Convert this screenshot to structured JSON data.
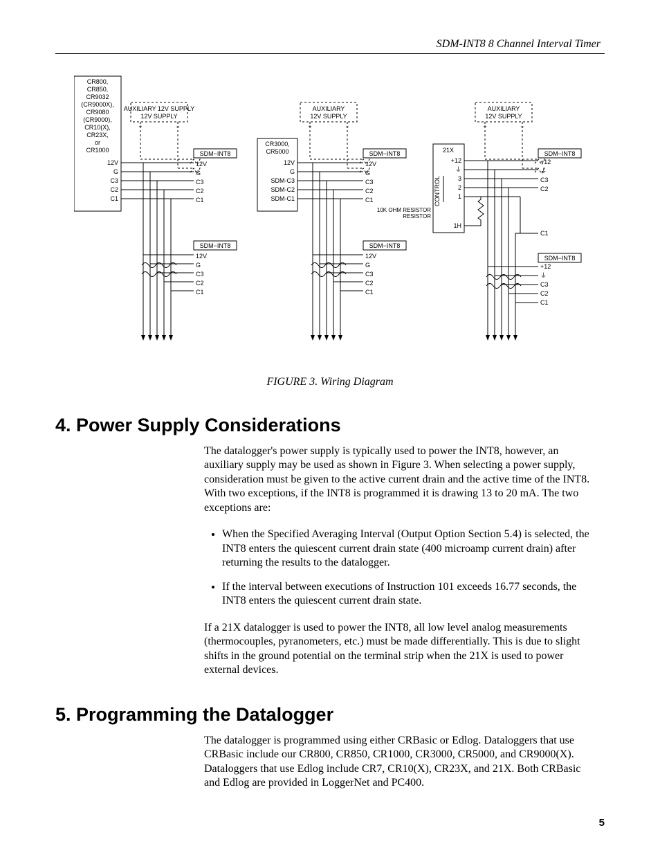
{
  "header": "SDM-INT8  8 Channel Interval Timer",
  "figure_caption": "FIGURE 3.  Wiring Diagram",
  "page_number": "5",
  "sections": {
    "s4": {
      "heading": "4.  Power Supply Considerations",
      "p1": "The datalogger's power supply is typically used to power the INT8, however, an auxiliary supply may be used as shown in Figure 3.  When selecting a power supply, consideration must be given to the active current drain and the active time of the INT8.  With two exceptions, if the INT8 is programmed it is drawing 13 to 20 mA.  The two exceptions are:",
      "b1": "When the Specified Averaging Interval (Output Option Section 5.4) is selected, the INT8 enters the quiescent current drain state (400 microamp current drain) after returning the results to the datalogger.",
      "b2": "If the interval between executions of Instruction 101 exceeds 16.77 seconds, the INT8 enters the quiescent current drain state.",
      "p2": "If a 21X datalogger is used to power the INT8, all low level analog measurements (thermocouples, pyranometers, etc.) must be made differentially.  This is due to slight shifts in the ground potential on the terminal strip when the 21X is used to power external devices."
    },
    "s5": {
      "heading": "5.  Programming the Datalogger",
      "p1": "The datalogger is programmed using either CRBasic or Edlog.  Dataloggers that use CRBasic include our CR800, CR850, CR1000, CR3000, CR5000, and CR9000(X).  Dataloggers that use Edlog include CR7, CR10(X), CR23X, and 21X.  Both CRBasic and Edlog are provided in LoggerNet and PC400."
    }
  },
  "diagram": {
    "aux_label": "AUXILIARY\n12V SUPPLY",
    "sdm_title": "SDM−INT8",
    "sdm_pins": [
      "12V",
      "G",
      "C3",
      "C2",
      "C1"
    ],
    "sdm_pins_21x": [
      "+12",
      "⏚",
      "C3",
      "C2",
      "",
      "C1"
    ],
    "sdm_pins_21x_bottom": [
      "+12",
      "⏚",
      "C3",
      "C2",
      "C1"
    ],
    "col1_logger_lines": [
      "CR800,",
      "CR850,",
      "CR9032",
      "(CR9000X),",
      "CR9080",
      "(CR9000),",
      "CR10(X),",
      "CR23X,",
      "or",
      "CR1000"
    ],
    "col1_logger_pins": [
      "12V",
      "G",
      "C3",
      "C2",
      "C1"
    ],
    "col2_logger_lines": [
      "CR3000,",
      "CR5000"
    ],
    "col2_logger_pins": [
      "12V",
      "G",
      "SDM-C3",
      "SDM-C2",
      "SDM-C1"
    ],
    "col3_logger_name": "21X",
    "col3_logger_pins": [
      "+12",
      "⏚",
      "3",
      "2",
      "1",
      "",
      "1H"
    ],
    "control_label": "CONTROL",
    "resistor_label": "10K OHM\nRESISTOR",
    "polarity_plus": "+",
    "polarity_minus": "−"
  }
}
